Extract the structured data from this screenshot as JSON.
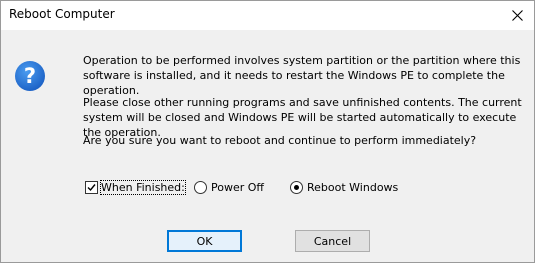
{
  "window": {
    "title": "Reboot Computer"
  },
  "icons": {
    "question": "question-icon",
    "close": "close-icon"
  },
  "messages": {
    "line1": "Operation to be performed involves system partition or the partition where this software is installed, and it needs to restart the Windows PE to complete the operation.",
    "line2": "Please close other running programs and save unfinished contents. The current system will be closed and Windows PE will be started automatically to execute the operation.",
    "question": "Are you sure you want to reboot and continue to perform immediately?"
  },
  "options": {
    "when_finished": {
      "label": "When Finished:",
      "checked": true
    },
    "power_off": {
      "label": "Power Off",
      "selected": false
    },
    "reboot_windows": {
      "label": "Reboot Windows",
      "selected": true
    }
  },
  "buttons": {
    "ok": "OK",
    "cancel": "Cancel"
  },
  "colors": {
    "icon_blue": "#1e6fd9",
    "default_button_border": "#0078d7"
  }
}
